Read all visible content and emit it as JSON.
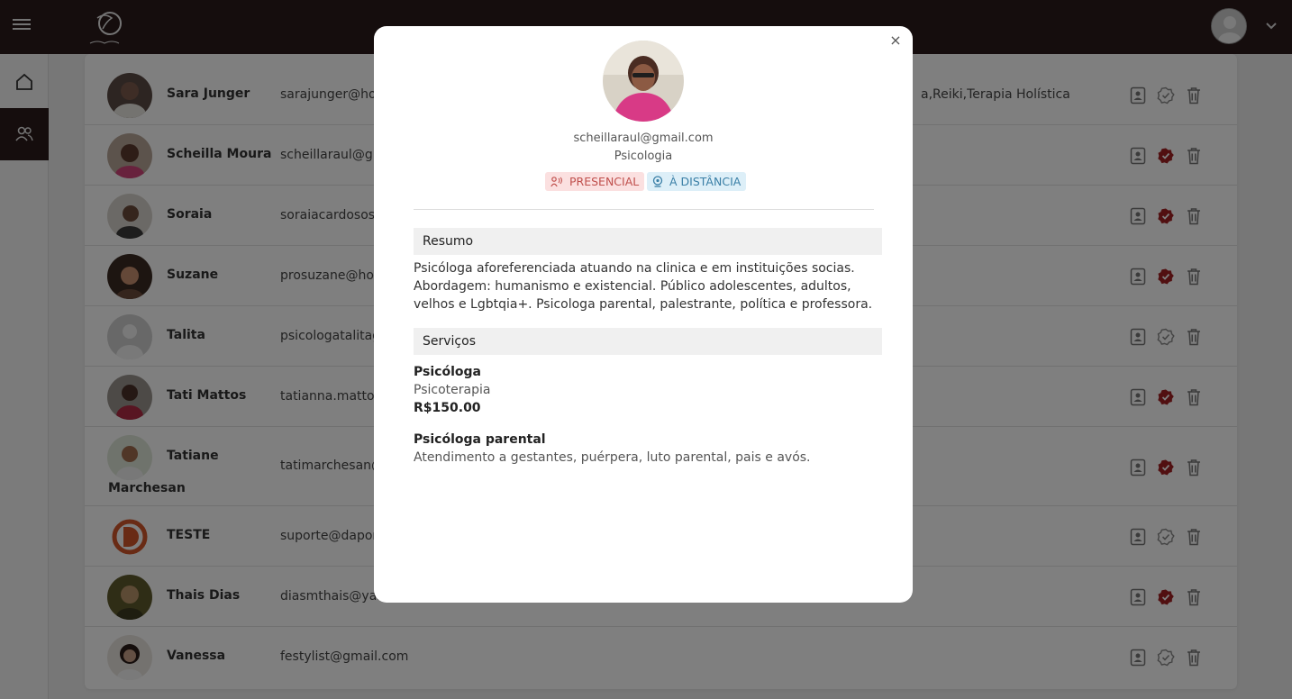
{
  "header": {
    "menu_icon": "hamburger-icon",
    "logo_icon": "brand-logo",
    "avatar_icon": "user-avatar",
    "caret_icon": "chevron-down-icon"
  },
  "sidebar": {
    "items": [
      {
        "icon": "home-icon",
        "label": "Home"
      },
      {
        "icon": "users-icon",
        "label": "Users"
      }
    ]
  },
  "table": {
    "rows": [
      {
        "name": "Sara Junger",
        "email": "sarajunger@hotmail.com",
        "extra": "a,Reiki,Terapia Holística",
        "verified": false
      },
      {
        "name": "Scheilla Moura",
        "email": "scheillaraul@gmail.com",
        "extra": "",
        "verified": true
      },
      {
        "name": "Soraia",
        "email": "soraiacardososilva@gmail.com",
        "extra": "",
        "verified": true
      },
      {
        "name": "Suzane",
        "email": "prosuzane@hotmail.com",
        "extra": "",
        "verified": true
      },
      {
        "name": "Talita",
        "email": "psicologatalitagomes@gmail.com",
        "extra": "",
        "verified": false
      },
      {
        "name": "Tati Mattos",
        "email": "tatianna.mattos@gmail.com",
        "extra": "",
        "verified": true
      },
      {
        "name": "Tatiane",
        "name2": "Marchesan",
        "email": "tatimarchesan@gmail.com",
        "extra": "",
        "verified": true
      },
      {
        "name": "TESTE",
        "email": "suporte@dapomba.com",
        "extra": "",
        "verified": false
      },
      {
        "name": "Thais Dias",
        "email": "diasmthais@yahoo.com.br",
        "extra": "",
        "verified": true
      },
      {
        "name": "Vanessa",
        "email": "festylist@gmail.com",
        "extra": "",
        "verified": false
      }
    ]
  },
  "modal": {
    "close_label": "×",
    "email": "scheillaraul@gmail.com",
    "specialty": "Psicologia",
    "tags": {
      "presencial": "PRESENCIAL",
      "distancia": "À DISTÂNCIA"
    },
    "summary_title": "Resumo",
    "summary_text": "Psicóloga aforeferenciada atuando na clinica e em instituições socias. Abordagem: humanismo e existencial. Público adolescentes, adultos, velhos e Lgbtqia+. Psicologa parental, palestrante, política e professora.",
    "services_title": "Serviços",
    "services": [
      {
        "title": "Psicóloga",
        "subtitle": "Psicoterapia",
        "price": "R$150.00"
      },
      {
        "title": "Psicóloga parental",
        "subtitle": "Atendimento a gestantes, puérpera, luto parental, pais e avós.",
        "price": ""
      }
    ]
  },
  "colors": {
    "topbar": "#2b1a1b",
    "verified": "#a32023",
    "tag_presencial_bg": "#fbe0e0",
    "tag_distancia_bg": "#ddeff8"
  }
}
